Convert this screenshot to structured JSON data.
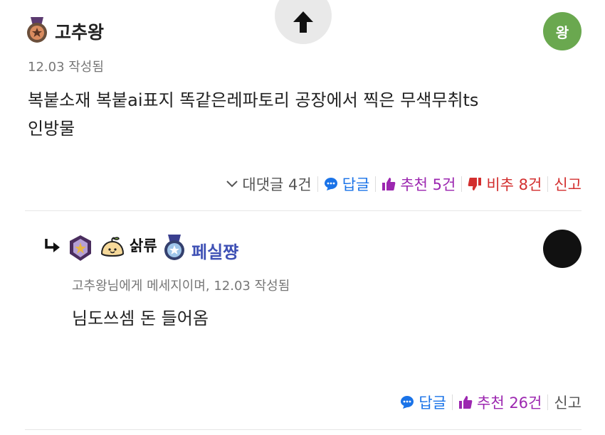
{
  "comment": {
    "author": "고추왕",
    "meta": "12.03 작성됨",
    "body_line1": "복붙소재 복붙ai표지 똑같은레파토리 공장에서 찍은 무색무취ts",
    "body_line2": "인방물",
    "avatar_letter": "왕",
    "avatar_color": "#6aa84f",
    "actions": {
      "subreplies": "대댓글 4건",
      "reply": "답글",
      "upvote": "추천 5건",
      "downvote": "비추 8건",
      "report": "신고"
    }
  },
  "reply": {
    "author": "페실쨩",
    "badge_text": "삵류",
    "meta": "고추왕님에게 메세지이며, 12.03 작성됨",
    "body": "님도쓰셈 돈 들어옴",
    "avatar_color": "#111111",
    "actions": {
      "reply": "답글",
      "upvote": "추천 26건",
      "report": "신고"
    }
  },
  "colors": {
    "link_blue": "#1a73e8",
    "upvote_purple": "#9c27b0",
    "downvote_red": "#d32f2f"
  },
  "icons": [
    "arrow-up-icon",
    "bronze-medal-icon",
    "chevron-down-icon",
    "chat-bubble-icon",
    "thumbs-up-icon",
    "thumbs-down-icon",
    "reply-arrow-icon",
    "purple-medal-icon",
    "dumpling-icon",
    "blue-medal-icon"
  ]
}
